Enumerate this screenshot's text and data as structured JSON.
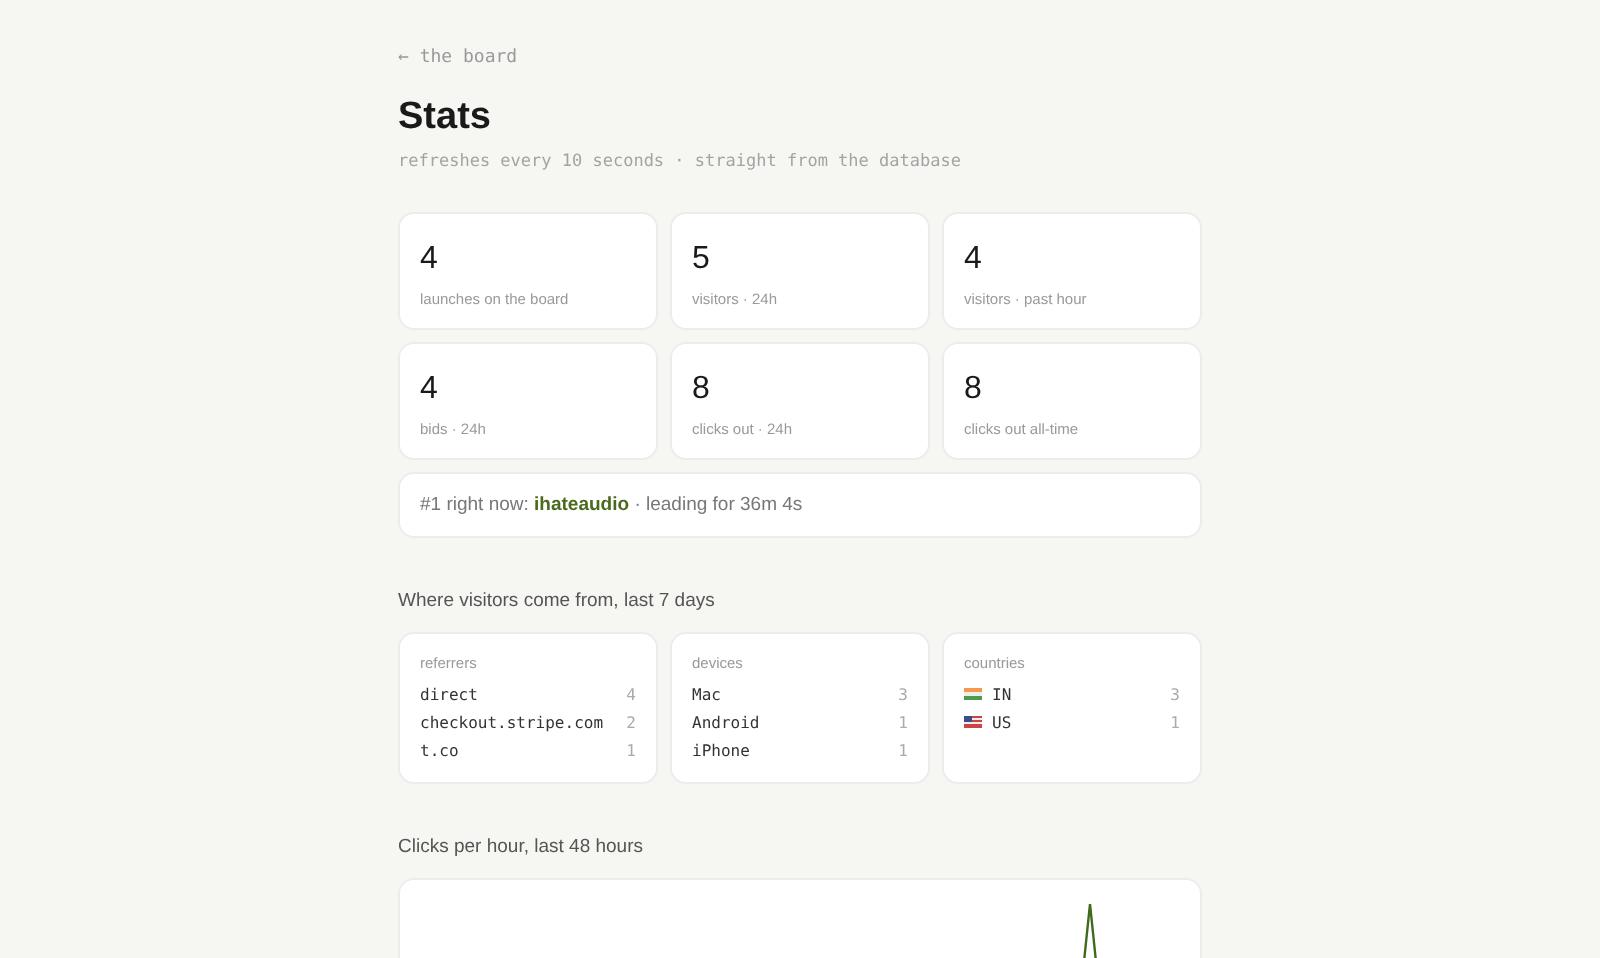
{
  "back_link": "← the board",
  "title": "Stats",
  "subtitle": "refreshes every 10 seconds · straight from the database",
  "stats": [
    {
      "value": "4",
      "label": "launches on the board"
    },
    {
      "value": "5",
      "label": "visitors · 24h"
    },
    {
      "value": "4",
      "label": "visitors · past hour"
    },
    {
      "value": "4",
      "label": "bids · 24h"
    },
    {
      "value": "8",
      "label": "clicks out · 24h"
    },
    {
      "value": "8",
      "label": "clicks out all-time"
    }
  ],
  "leader": {
    "prefix": "#1 right now:",
    "name": "ihateaudio",
    "suffix": "· leading for 36m 4s"
  },
  "sources_heading": "Where visitors come from, last 7 days",
  "sources": [
    {
      "title": "referrers",
      "rows": [
        {
          "name": "direct",
          "count": "4"
        },
        {
          "name": "checkout.stripe.com",
          "count": "2"
        },
        {
          "name": "t.co",
          "count": "1"
        }
      ]
    },
    {
      "title": "devices",
      "rows": [
        {
          "name": "Mac",
          "count": "3"
        },
        {
          "name": "Android",
          "count": "1"
        },
        {
          "name": "iPhone",
          "count": "1"
        }
      ]
    },
    {
      "title": "countries",
      "rows": [
        {
          "kind": "india",
          "name": "IN",
          "count": "3"
        },
        {
          "kind": "usa",
          "name": "US",
          "count": "1"
        }
      ]
    }
  ],
  "chart_heading": "Clicks per hour, last 48 hours"
}
